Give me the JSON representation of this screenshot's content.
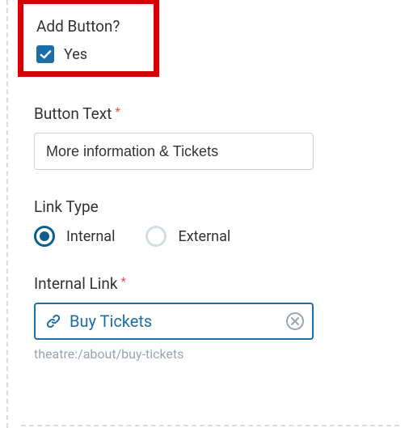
{
  "addButton": {
    "label": "Add Button?",
    "checkbox_label": "Yes",
    "checked": true
  },
  "buttonText": {
    "label": "Button Text",
    "value": "More information & Tickets"
  },
  "linkType": {
    "label": "Link Type",
    "options": [
      {
        "label": "Internal",
        "selected": true
      },
      {
        "label": "External",
        "selected": false
      }
    ]
  },
  "internalLink": {
    "label": "Internal Link",
    "value": "Buy Tickets",
    "path": "theatre:/about/buy-tickets"
  },
  "colors": {
    "accent": "#1b6ea8",
    "highlight": "#d40000"
  }
}
